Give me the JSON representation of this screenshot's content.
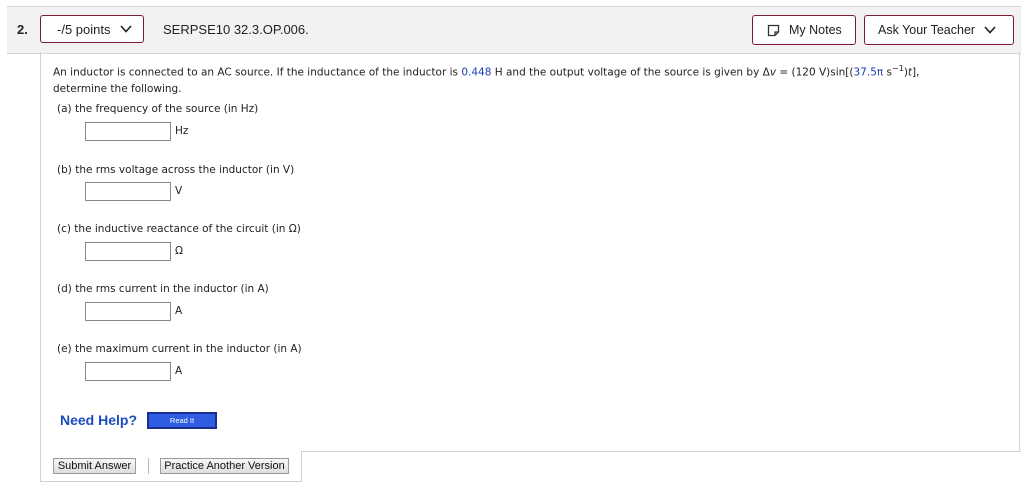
{
  "header": {
    "question_number": "2.",
    "points_label": "-/5 points",
    "question_id": "SERPSE10 32.3.OP.006.",
    "my_notes_label": "My Notes",
    "ask_teacher_label": "Ask Your Teacher"
  },
  "question": {
    "intro_1": "An inductor is connected to an AC source. If the inductance of the inductor is ",
    "inductance_value": "0.448",
    "intro_2": " H and the output voltage of the source is given by Δ",
    "v_symbol": "v",
    "intro_3": " = (120 V)sin[(",
    "omega_value": "37.5π",
    "intro_4": " s",
    "exponent": "−1",
    "intro_5": ")",
    "t_symbol": "t",
    "intro_6": "],",
    "intro_line2": "determine the following."
  },
  "parts": [
    {
      "label": "(a)   the frequency of the source (in Hz)",
      "unit": "Hz",
      "value": ""
    },
    {
      "label": "(b)   the rms voltage across the inductor (in V)",
      "unit": "V",
      "value": ""
    },
    {
      "label": "(c)   the inductive reactance of the circuit (in Ω)",
      "unit": "Ω",
      "value": ""
    },
    {
      "label": "(d)   the rms current in the inductor (in A)",
      "unit": "A",
      "value": ""
    },
    {
      "label": "(e)   the maximum current in the inductor (in A)",
      "unit": "A",
      "value": ""
    }
  ],
  "help": {
    "need_help": "Need Help?",
    "read_it": "Read It"
  },
  "footer": {
    "submit_label": "Submit Answer",
    "practice_label": "Practice Another Version"
  },
  "colors": {
    "button_border": "#7a1b2e",
    "value_blue": "#1a3cb4",
    "help_blue": "#1a4cc0"
  }
}
